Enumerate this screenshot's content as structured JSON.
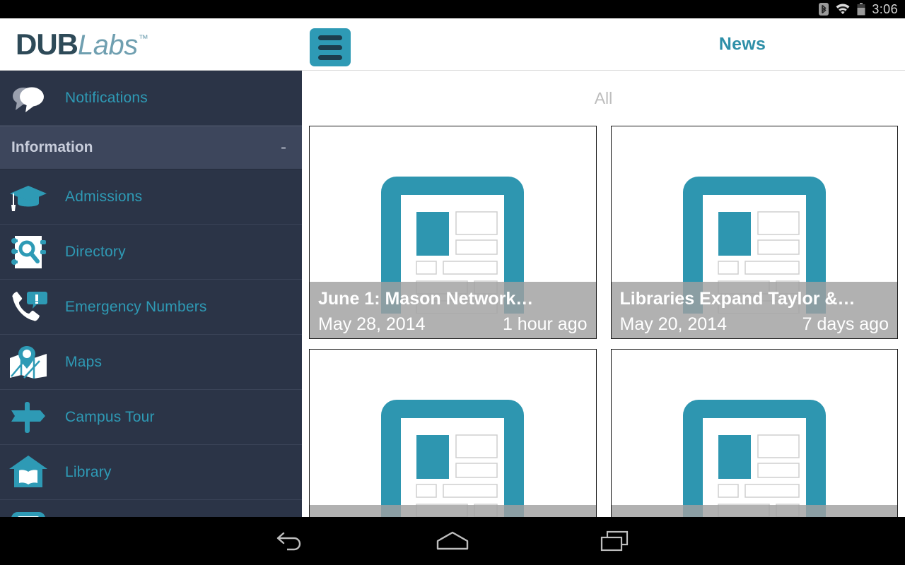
{
  "status_bar": {
    "time": "3:06",
    "icons": [
      "bluetooth-icon",
      "wifi-icon",
      "battery-icon"
    ]
  },
  "app_bar": {
    "logo_primary": "DUB",
    "logo_secondary": "Labs",
    "logo_trademark": "™",
    "menu_icon": "hamburger-menu-icon",
    "title": "News",
    "accent_color": "#2e9ab5",
    "title_color": "#2e8fa8"
  },
  "sidebar": {
    "background_color": "#2b3447",
    "items": [
      {
        "label": "Notifications",
        "icon": "speech-bubbles-icon",
        "type": "item"
      },
      {
        "label": "Information",
        "icon": "",
        "type": "section",
        "toggle": "-"
      },
      {
        "label": "Admissions",
        "icon": "graduation-cap-icon",
        "type": "item"
      },
      {
        "label": "Directory",
        "icon": "address-book-search-icon",
        "type": "item"
      },
      {
        "label": "Emergency Numbers",
        "icon": "phone-alert-icon",
        "type": "item"
      },
      {
        "label": "Maps",
        "icon": "map-pin-icon",
        "type": "item"
      },
      {
        "label": "Campus Tour",
        "icon": "signpost-icon",
        "type": "item"
      },
      {
        "label": "Library",
        "icon": "library-building-icon",
        "type": "item"
      },
      {
        "label": "",
        "icon": "shuttle-bus-icon",
        "type": "item"
      }
    ]
  },
  "content": {
    "filter_label": "All",
    "cards": [
      {
        "title": "June 1: Mason Network…",
        "date": "May 28, 2014",
        "relative_time": "1 hour ago",
        "image": "news-placeholder-icon"
      },
      {
        "title": "Libraries Expand Taylor &…",
        "date": "May 20, 2014",
        "relative_time": "7 days ago",
        "image": "news-placeholder-icon"
      },
      {
        "title": "",
        "date": "",
        "relative_time": "",
        "image": "news-placeholder-icon"
      },
      {
        "title": "",
        "date": "",
        "relative_time": "",
        "image": "news-placeholder-icon"
      }
    ]
  },
  "nav_bar": {
    "back_label": "back-icon",
    "home_label": "home-icon",
    "recents_label": "recents-icon"
  }
}
